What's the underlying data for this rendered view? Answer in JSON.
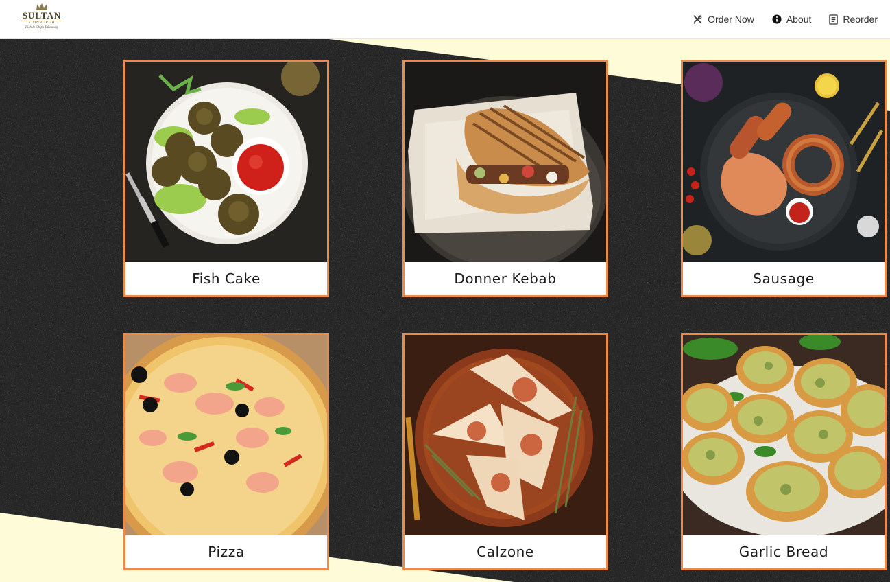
{
  "brand": {
    "name": "SULTAN",
    "tagline": "EDINBURGH",
    "subtitle": "Fish & Chips Takeaway"
  },
  "nav": {
    "items": [
      {
        "label": "Order Now",
        "icon": "utensils-icon"
      },
      {
        "label": "About",
        "icon": "info-circle-icon"
      },
      {
        "label": "Reorder",
        "icon": "receipt-icon"
      },
      {
        "label": "",
        "icon": "cart-icon"
      }
    ]
  },
  "menu": {
    "items": [
      {
        "label": "Fish Cake"
      },
      {
        "label": "Donner Kebab"
      },
      {
        "label": "Sausage"
      },
      {
        "label": "Pizza"
      },
      {
        "label": "Calzone"
      },
      {
        "label": "Garlic Bread"
      }
    ]
  },
  "colors": {
    "accent_border": "#ec8a4c",
    "background_stone": "#262626",
    "background_cream": "#fdfbd8",
    "header": "#ffffff"
  }
}
